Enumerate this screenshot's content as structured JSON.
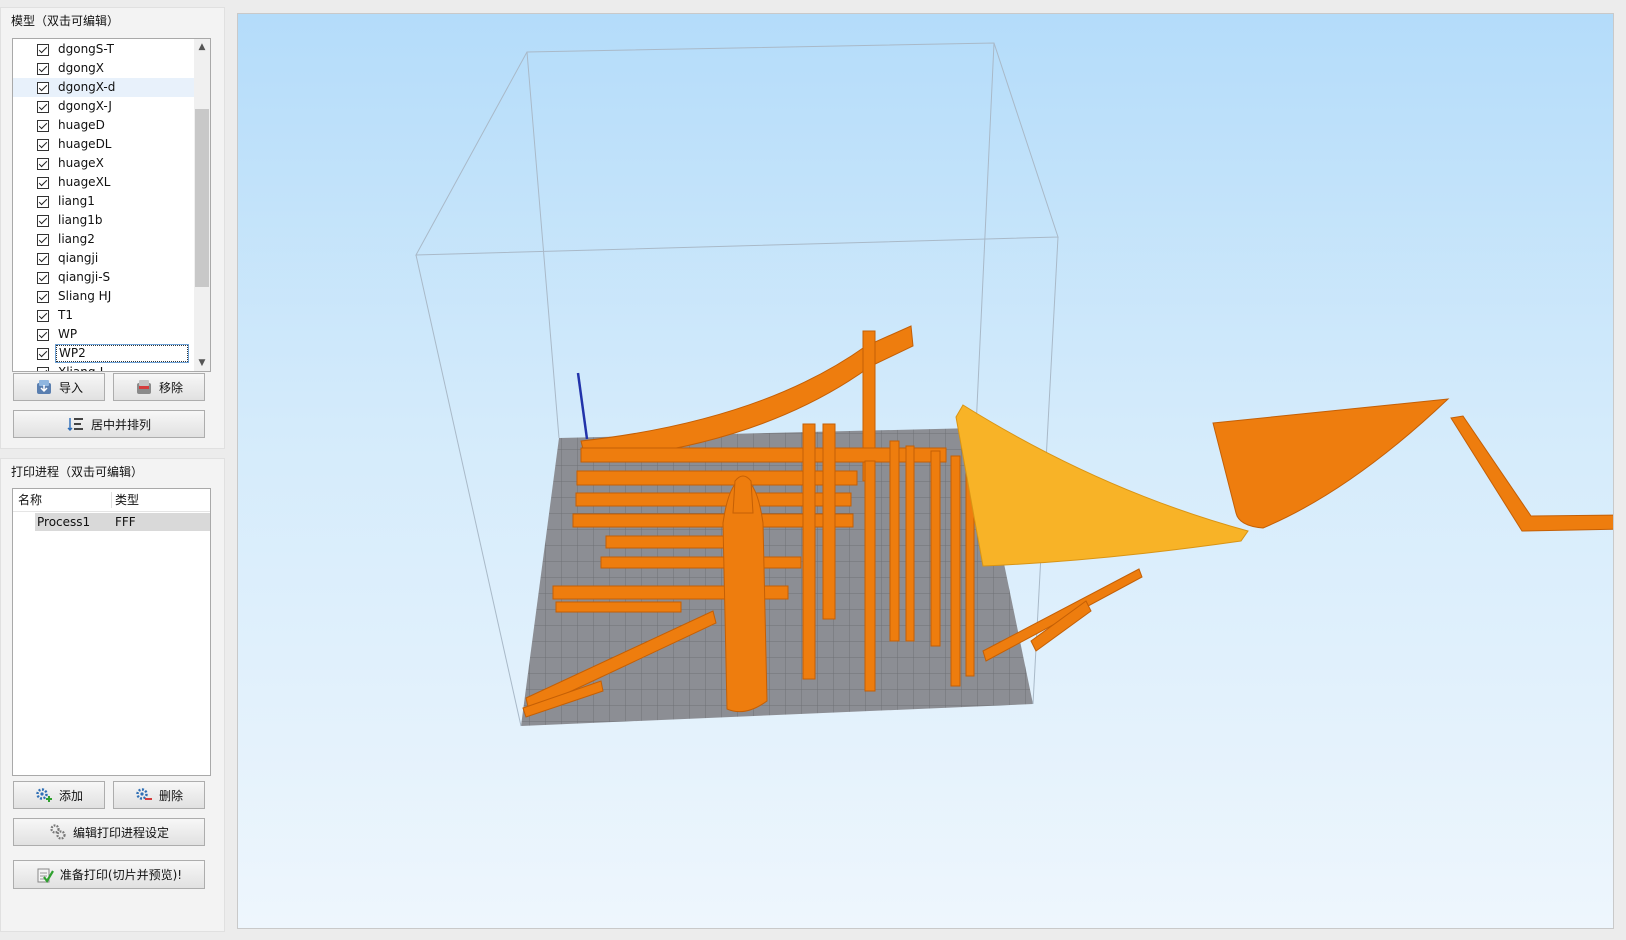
{
  "model_panel": {
    "title": "模型（双击可编辑）",
    "items": [
      {
        "label": "dgongS-T",
        "checked": true
      },
      {
        "label": "dgongX",
        "checked": true
      },
      {
        "label": "dgongX-d",
        "checked": true
      },
      {
        "label": "dgongX-J",
        "checked": true
      },
      {
        "label": "huageD",
        "checked": true
      },
      {
        "label": "huageDL",
        "checked": true
      },
      {
        "label": "huageX",
        "checked": true
      },
      {
        "label": "huageXL",
        "checked": true
      },
      {
        "label": "liang1",
        "checked": true
      },
      {
        "label": "liang1b",
        "checked": true
      },
      {
        "label": "liang2",
        "checked": true
      },
      {
        "label": "qiangji",
        "checked": true
      },
      {
        "label": "qiangji-S",
        "checked": true
      },
      {
        "label": "Sliang HJ",
        "checked": true
      },
      {
        "label": "T1",
        "checked": true
      },
      {
        "label": "WP",
        "checked": true
      },
      {
        "label": "WP2",
        "checked": true
      },
      {
        "label": "Xliang-L",
        "checked": true
      }
    ],
    "import_button": "导入",
    "remove_button": "移除",
    "center_arrange_button": "居中并排列"
  },
  "process_panel": {
    "title": "打印进程（双击可编辑）",
    "columns": [
      "名称",
      "类型"
    ],
    "rows": [
      {
        "name": "Process1",
        "type": "FFF"
      }
    ],
    "add_button": "添加",
    "delete_button": "删除",
    "edit_settings_button": "编辑打印进程设定",
    "prepare_print_button": "准备打印(切片并预览)!"
  },
  "colors": {
    "model_orange": "#ee7d0e",
    "model_yellow": "#f8b327",
    "build_plate": "#8c8e94",
    "viewport_sky_top": "#b4dcfa",
    "viewport_sky_bottom": "#eef6fd",
    "axis_blue": "#2233aa"
  }
}
